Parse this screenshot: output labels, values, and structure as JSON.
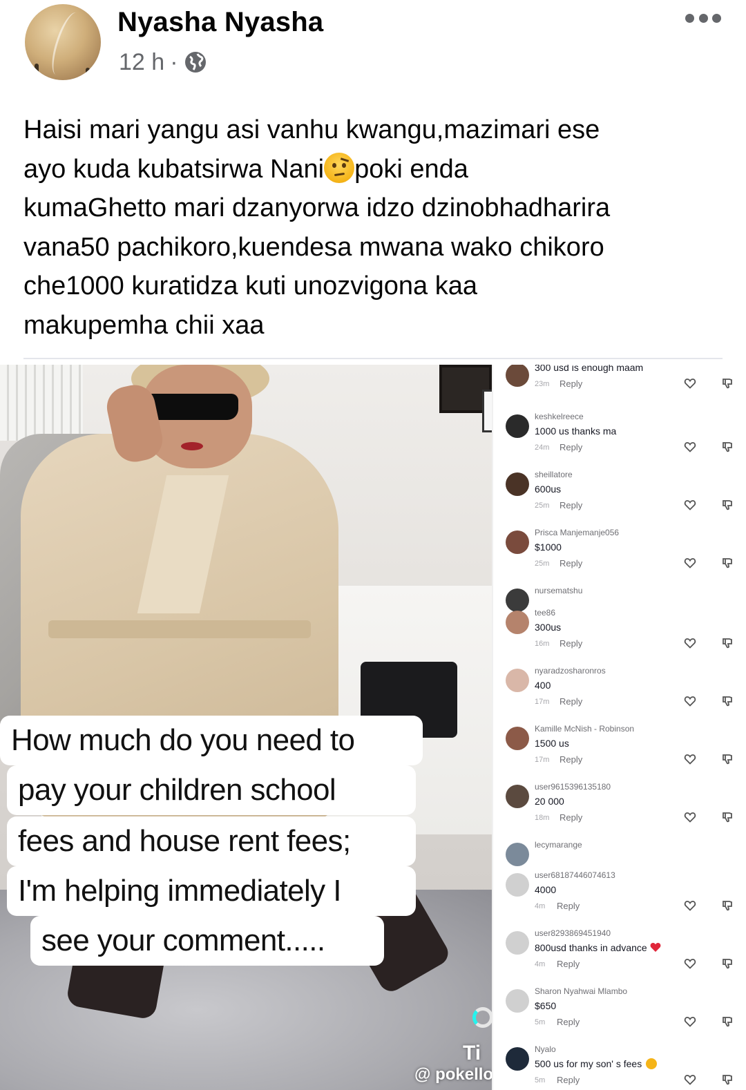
{
  "post": {
    "author": "Nyasha Nyasha",
    "time": "12 h",
    "separator": "·",
    "audience_icon": "globe-icon",
    "more_icon": "more-options-icon",
    "text_part1": "Haisi mari yangu asi vanhu kwangu,mazimari ese\nayo kuda kubatsirwa Nani",
    "text_emoji": "face-with-raised-eyebrow-emoji",
    "text_part2": "poki enda\nkumaGhetto mari dzanyorwa idzo dzinobhadharira\nvana50 pachikoro,kuendesa mwana wako chikoro\nche1000 kuratidza kuti unozvigona kaa\nmakupemha chii xaa"
  },
  "media": {
    "caption_lines": [
      "How much do you need to",
      "pay your children school",
      "fees and house rent fees;",
      "I'm helping immediately I",
      "see your comment....."
    ],
    "watermark_brand": "Ti",
    "watermark_handle": "@ pokello"
  },
  "comments": {
    "reply_label": "Reply",
    "items": [
      {
        "user": "",
        "text": "300 usd is enough maam",
        "time": "23m"
      },
      {
        "user": "keshkelreece",
        "text": "1000 us thanks ma",
        "time": "24m"
      },
      {
        "user": "sheillatore",
        "text": "600us",
        "time": "25m"
      },
      {
        "user": "Prisca Manjemanje056",
        "text": "$1000",
        "time": "25m"
      },
      {
        "user": "nursematshu",
        "text": "",
        "time": ""
      },
      {
        "user": "tee86",
        "text": "300us",
        "time": "16m"
      },
      {
        "user": "nyaradzosharonros",
        "text": "400",
        "time": "17m"
      },
      {
        "user": "Kamille McNish - Robinson",
        "text": "1500 us",
        "time": "17m"
      },
      {
        "user": "user9615396135180",
        "text": "20 000",
        "time": "18m"
      },
      {
        "user": "lecymarange",
        "text": "",
        "time": ""
      },
      {
        "user": "user68187446074613",
        "text": "4000",
        "time": "4m"
      },
      {
        "user": "user8293869451940",
        "text": "800usd thanks in advance",
        "time": "4m"
      },
      {
        "user": "Sharon Nyahwai Mlambo",
        "text": "$650",
        "time": "5m"
      },
      {
        "user": "Nyalo",
        "text": "500 us for my son' s fees",
        "time": "5m"
      }
    ]
  },
  "colors": {
    "text_primary": "#050505",
    "text_secondary": "#65676b",
    "heart_emoji": "#e0263a"
  }
}
